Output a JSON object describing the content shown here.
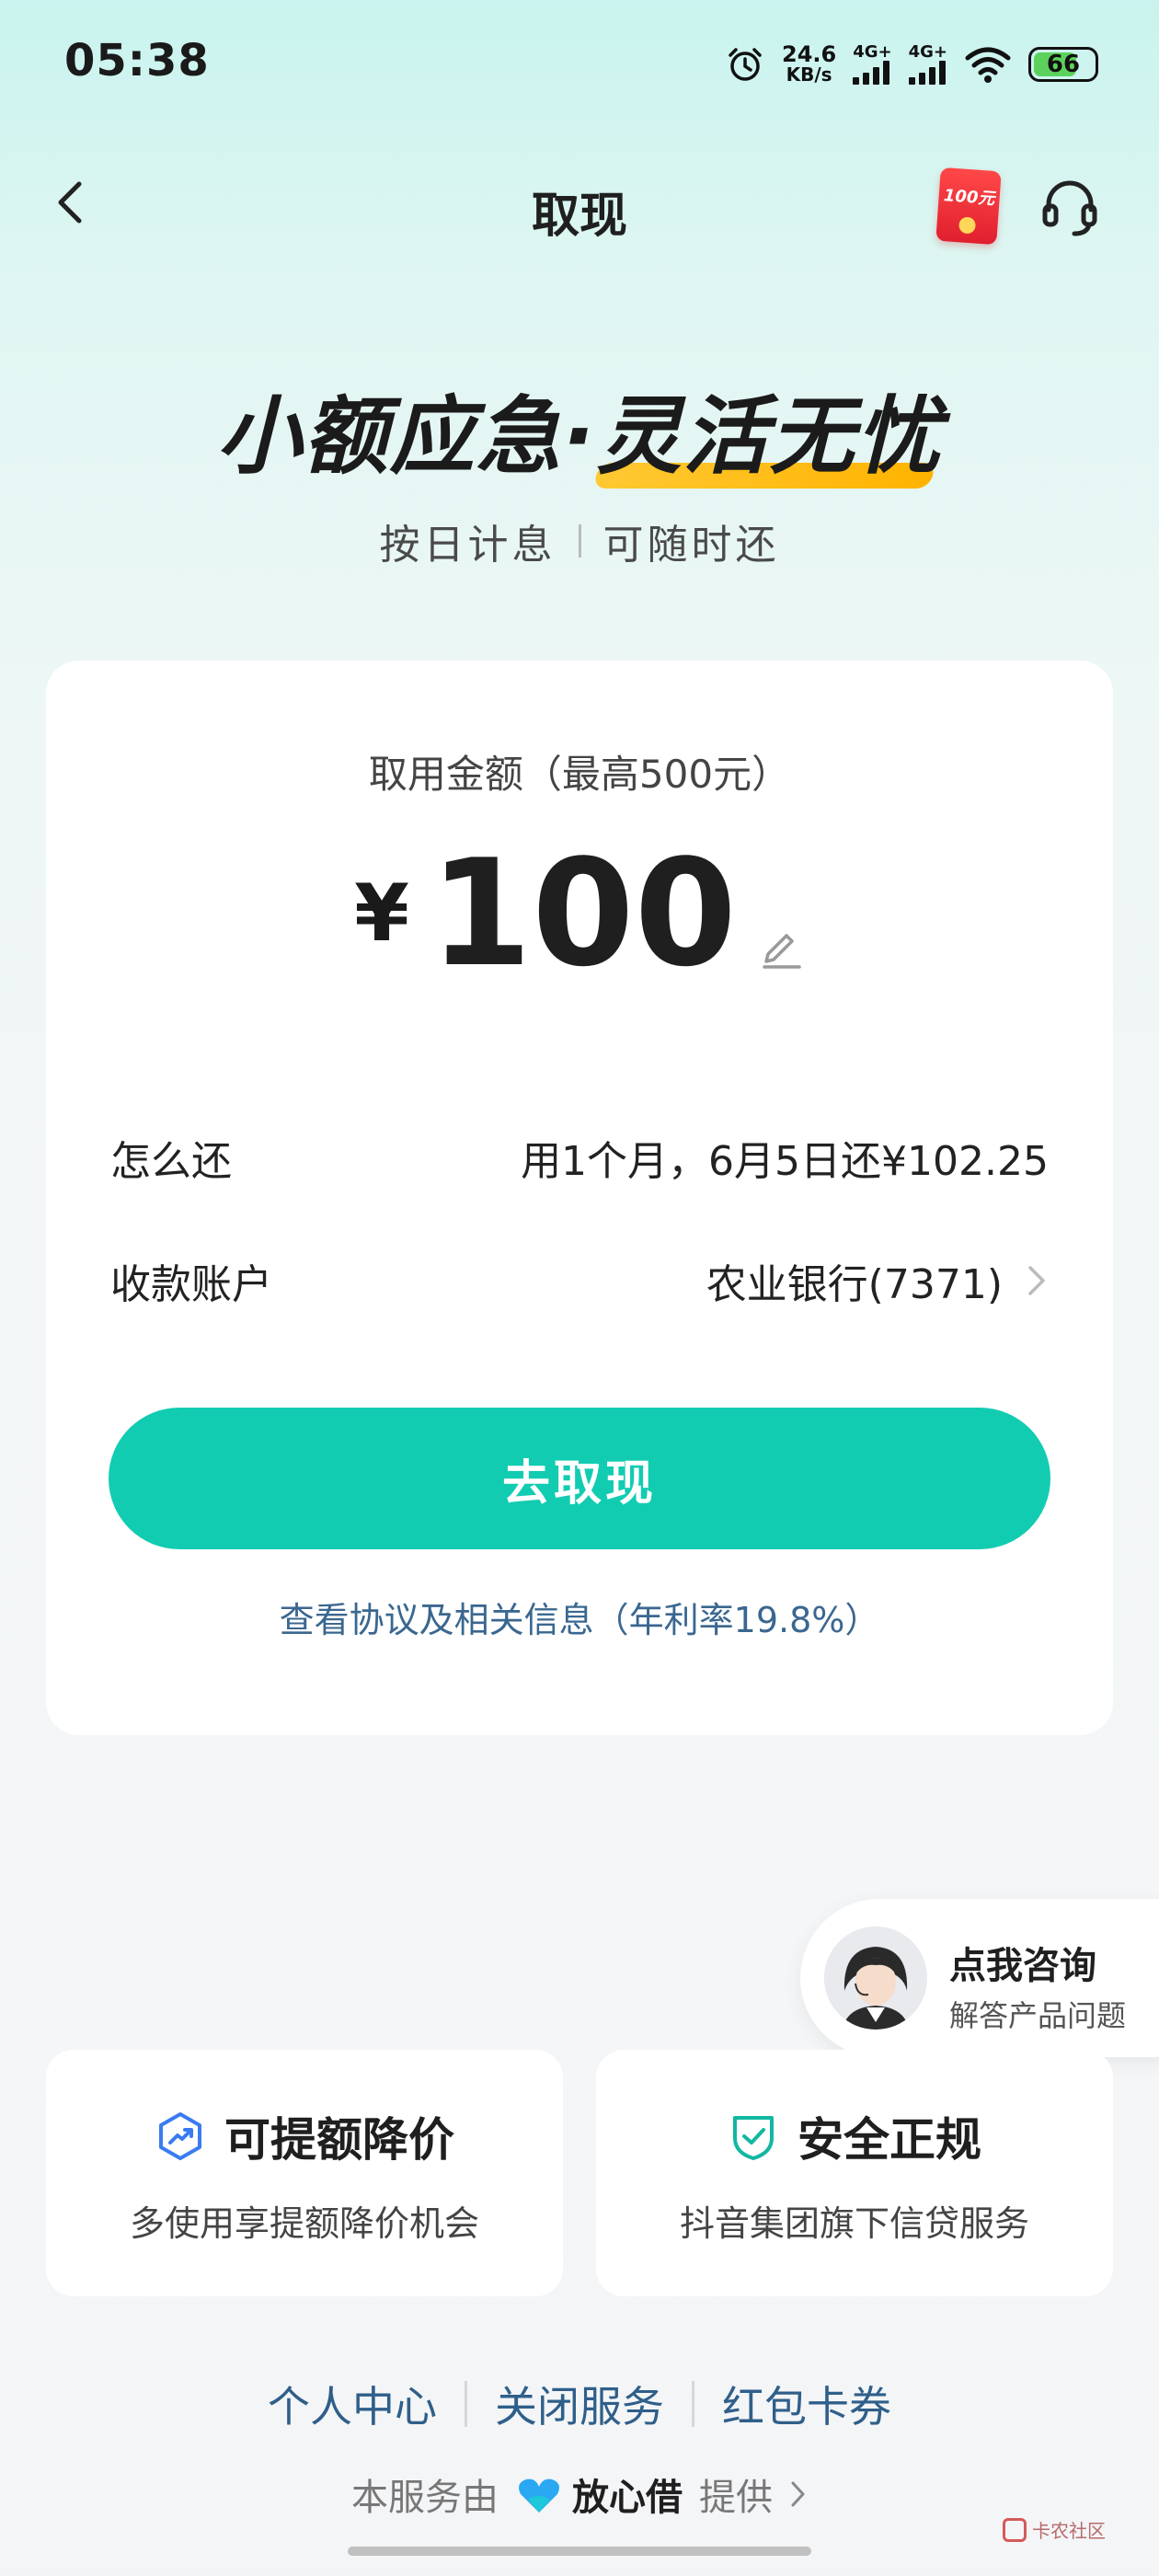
{
  "status_bar": {
    "time": "05:38",
    "net_speed_value": "24.6",
    "net_speed_unit": "KB/s",
    "sim1_label": "4G+",
    "sim2_label": "4G+",
    "battery": "66",
    "icons": [
      "alarm-icon",
      "signal-icon",
      "signal-icon",
      "wifi-icon",
      "battery-icon"
    ]
  },
  "nav": {
    "title": "取现",
    "back_icon": "chevron-left-icon",
    "redpacket_label": "100元",
    "support_icon": "headset-icon"
  },
  "hero": {
    "slogan_part1": "小额应急·",
    "slogan_part2": "灵活无忧",
    "sub_left": "按日计息",
    "sub_right": "可随时还"
  },
  "withdraw_card": {
    "amount_label": "取用金额（最高500元）",
    "currency_symbol": "¥",
    "amount_value": "100",
    "repay_label": "怎么还",
    "repay_value": "用1个月，6月5日还¥102.25",
    "account_label": "收款账户",
    "account_value": "农业银行(7371)",
    "cta_label": "去取现",
    "agreement_text": "查看协议及相关信息（年利率19.8%）"
  },
  "consult": {
    "title": "点我咨询",
    "subtitle": "解答产品问题"
  },
  "features": [
    {
      "title": "可提额降价",
      "desc": "多使用享提额降价机会",
      "icon": "trend-up-hexagon-icon",
      "color": "#3a7bf0"
    },
    {
      "title": "安全正规",
      "desc": "抖音集团旗下信贷服务",
      "icon": "shield-check-icon",
      "color": "#12b8a0"
    }
  ],
  "footer": {
    "links": [
      "个人中心",
      "关闭服务",
      "红包卡券"
    ],
    "provider_prefix": "本服务由",
    "provider_name": "放心借",
    "provider_suffix": "提供"
  },
  "watermark": "卡农社区",
  "colors": {
    "accent": "#12ccb1",
    "link": "#2f5f8a",
    "agreement": "#3a6790"
  }
}
